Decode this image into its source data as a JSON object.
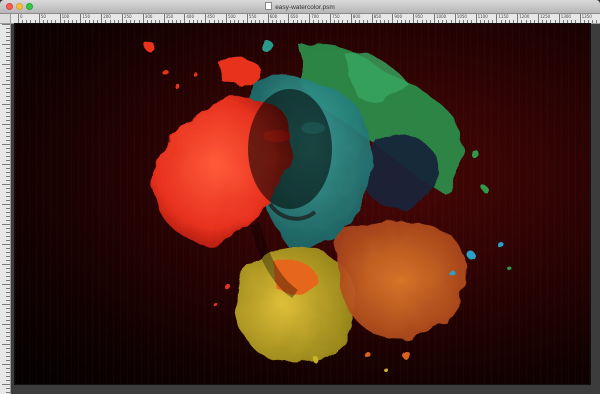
{
  "window": {
    "title": "easy-watercolor.psm",
    "icons": {
      "close": "close-icon",
      "minimize": "minimize-icon",
      "maximize": "maximize-icon",
      "document": "document-icon"
    }
  },
  "ruler": {
    "labels": [
      "0",
      "50",
      "100",
      "150",
      "200",
      "250",
      "300",
      "350",
      "400",
      "450",
      "500",
      "550",
      "600",
      "650",
      "700",
      "750",
      "800",
      "850",
      "900",
      "950",
      "1000",
      "1050",
      "1100",
      "1150",
      "1200",
      "1250",
      "1300",
      "1350",
      "1400"
    ]
  },
  "canvas": {
    "content": "watercolor-portrait-artwork",
    "colors": {
      "background": "#2c0303",
      "red": "#e8321f",
      "teal": "#1f8a86",
      "green": "#2f9a4a",
      "yellow": "#c9b22a",
      "orange": "#d9631e"
    }
  }
}
